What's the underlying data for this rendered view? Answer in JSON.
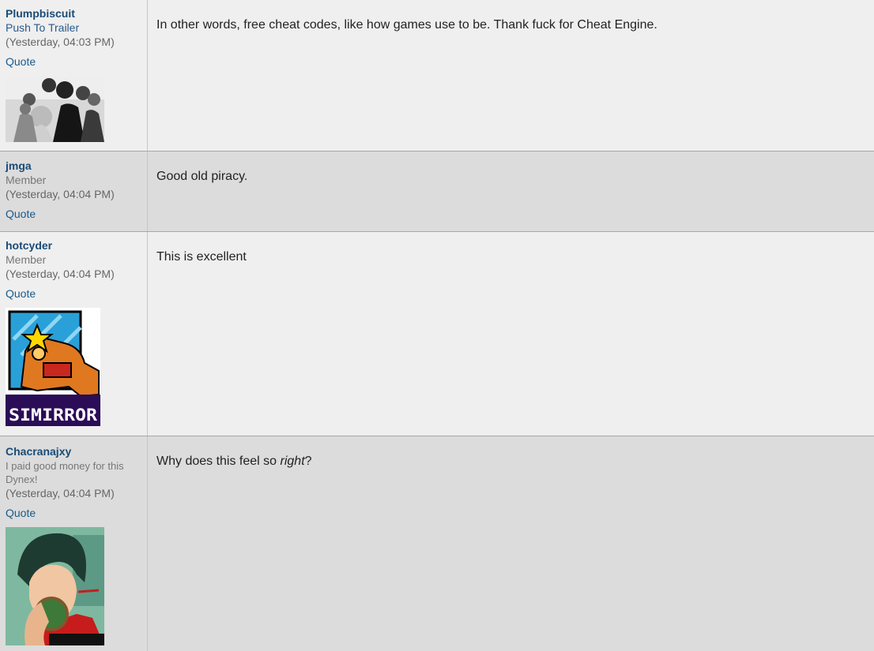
{
  "posts": [
    {
      "username": "Plumpbiscuit",
      "title": "Push To Trailer",
      "time": "(Yesterday, 04:03 PM)",
      "quote": "Quote",
      "message": "In other words, free cheat codes, like how games use to be. Thank fuck for Cheat Engine."
    },
    {
      "username": "jmga",
      "title": "Member",
      "time": "(Yesterday, 04:04 PM)",
      "quote": "Quote",
      "message": "Good old piracy."
    },
    {
      "username": "hotcyder",
      "title": "Member",
      "time": "(Yesterday, 04:04 PM)",
      "quote": "Quote",
      "message": "This is excellent",
      "avatar_text": "SIMIRROR"
    },
    {
      "username": "Chacranajxy",
      "title": "I paid good money for this Dynex!",
      "time": "(Yesterday, 04:04 PM)",
      "quote": "Quote",
      "message_before": "Why does this feel so ",
      "message_emphasis": "right",
      "message_after": "?"
    }
  ],
  "colors": {
    "username": "#1a4b77",
    "link": "#1a5a8a",
    "row_light": "#efefef",
    "row_dark": "#dcdcdc"
  }
}
